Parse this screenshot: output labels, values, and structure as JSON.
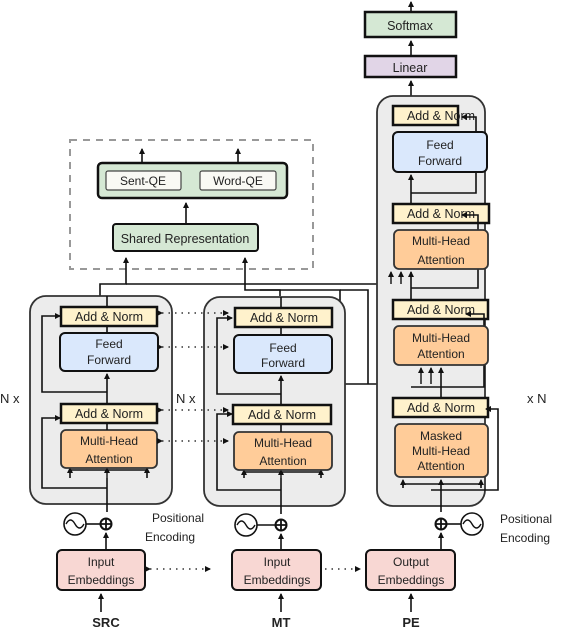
{
  "colors": {
    "stack_bg": "#ececec",
    "add_norm": "#fff2cc",
    "feed_forward": "#dae8fc",
    "attention": "#ffcc99",
    "embedding": "#f8d7d3",
    "green": "#d5e8d4",
    "linear": "#e1d5e7",
    "qe_inner": "#f9f9f4"
  },
  "qe_module": {
    "sent_qe": "Sent-QE",
    "word_qe": "Word-QE",
    "shared_representation": "Shared Representation"
  },
  "encoder_src": {
    "repeat_label": "N x",
    "add_norm_top": "Add & Norm",
    "feed_forward": [
      "Feed",
      "Forward"
    ],
    "add_norm_bottom": "Add & Norm",
    "attention": [
      "Multi-Head",
      "Attention"
    ],
    "embedding": [
      "Input",
      "Embeddings"
    ],
    "input_label": "SRC"
  },
  "encoder_mt": {
    "repeat_label": "N x",
    "add_norm_top": "Add & Norm",
    "feed_forward": [
      "Feed",
      "Forward"
    ],
    "add_norm_bottom": "Add & Norm",
    "attention": [
      "Multi-Head",
      "Attention"
    ],
    "embedding": [
      "Input",
      "Embeddings"
    ],
    "input_label": "MT"
  },
  "decoder": {
    "repeat_label": "x N",
    "softmax": "Softmax",
    "linear": "Linear",
    "add_norm_1": "Add & Norm",
    "feed_forward": [
      "Feed",
      "Forward"
    ],
    "add_norm_2": "Add & Norm",
    "cross_attention": [
      "Multi-Head",
      "Attention"
    ],
    "add_norm_3": "Add & Norm",
    "cross_attention_2": [
      "Multi-Head",
      "Attention"
    ],
    "add_norm_4": "Add & Norm",
    "masked_attention": [
      "Masked",
      "Multi-Head",
      "Attention"
    ],
    "embedding": [
      "Output",
      "Embeddings"
    ],
    "input_label": "PE"
  },
  "positional_encoding_label": [
    "Positional",
    "Encoding"
  ]
}
